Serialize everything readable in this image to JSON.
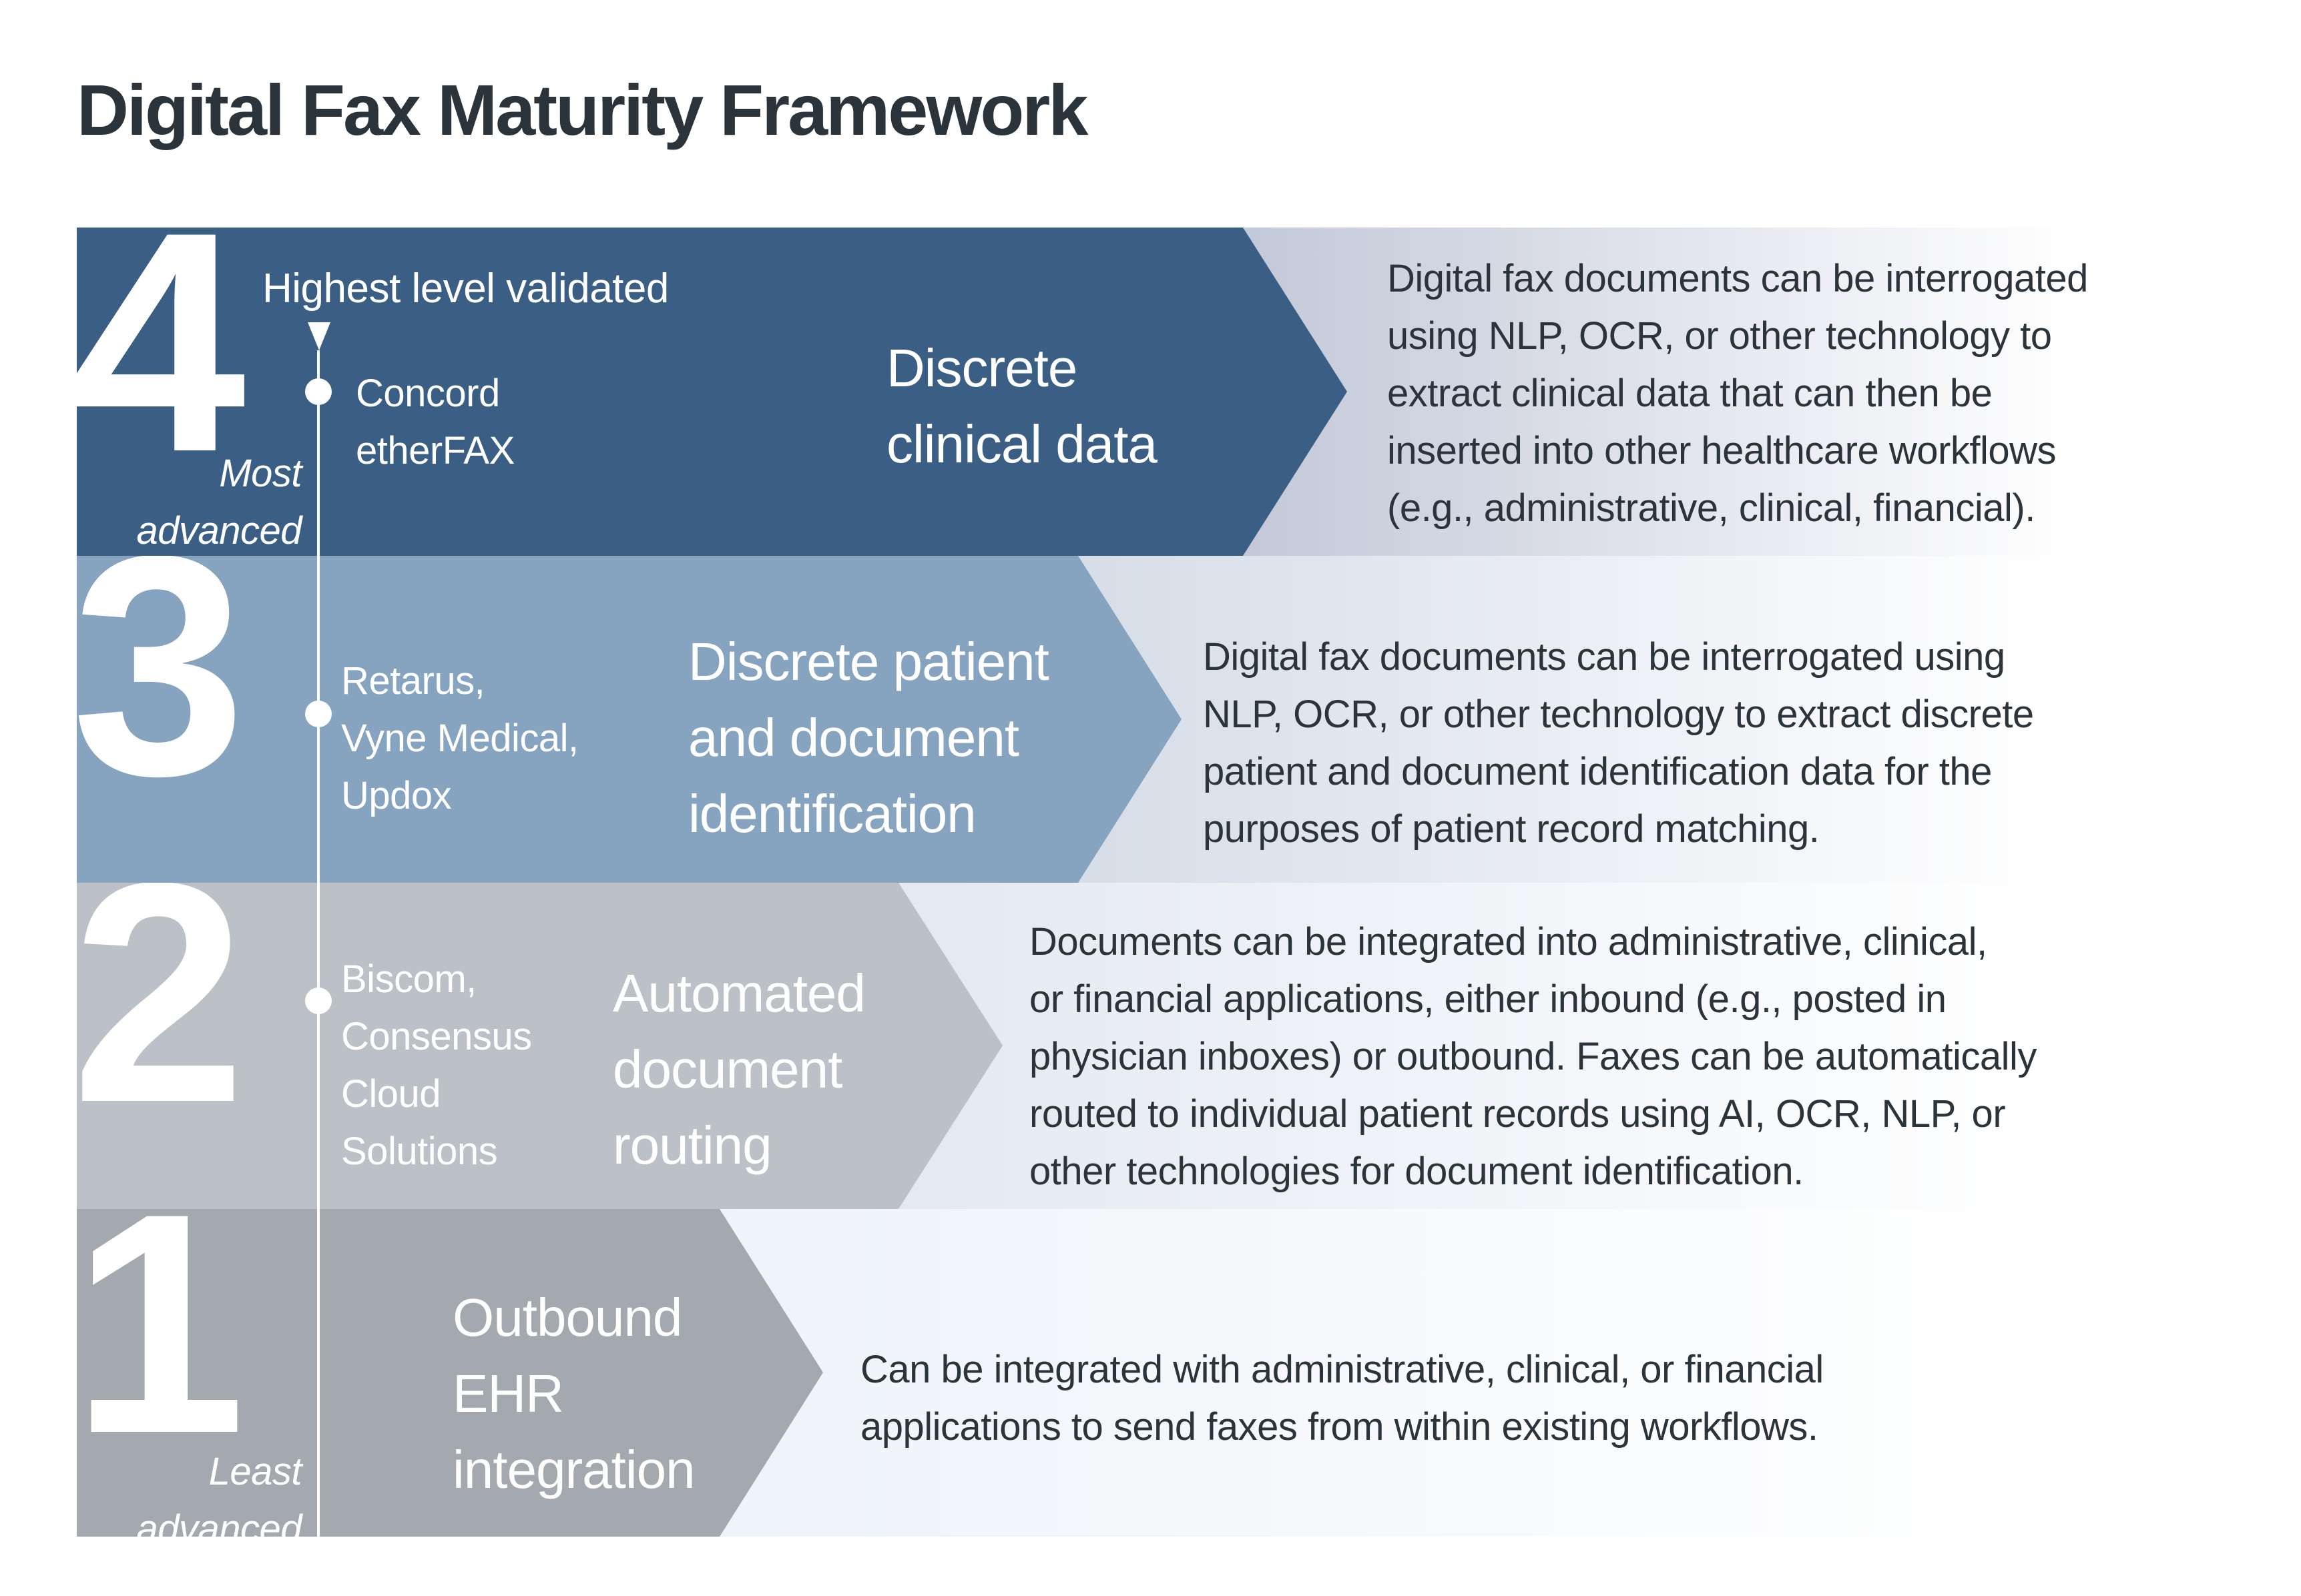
{
  "title": "Digital Fax Maturity Framework",
  "timeline": {
    "marker_label": "Highest level validated",
    "top_label": [
      "Most",
      "advanced"
    ],
    "bottom_label": [
      "Least",
      "advanced"
    ]
  },
  "colors": {
    "title": "#2b333b",
    "level4": "#3b5f84",
    "level3": "#86a4c0",
    "level2": "#bcc1c8",
    "level1": "#a4a9b0",
    "level4_panel": "#bcc2d4",
    "level3_panel": "#d3dbe6",
    "level2_panel": "#e3e9f1",
    "level1_panel": "#eef3f8"
  },
  "levels": [
    {
      "number": "4",
      "title_lines": [
        "Discrete",
        "clinical data"
      ],
      "vendors": [
        "Concord",
        "etherFAX"
      ],
      "description_lines": [
        "Digital fax documents can be interrogated",
        "using NLP, OCR, or other technology to",
        "extract clinical data that can then be",
        "inserted into other healthcare workflows",
        "(e.g., administrative, clinical, financial)."
      ]
    },
    {
      "number": "3",
      "title_lines": [
        "Discrete patient",
        "and document",
        "identification"
      ],
      "vendors": [
        "Retarus,",
        "Vyne Medical,",
        "Updox"
      ],
      "description_lines": [
        "Digital fax documents can be interrogated using",
        "NLP, OCR, or other technology to extract discrete",
        "patient and document identification data for the",
        "purposes of patient record matching."
      ]
    },
    {
      "number": "2",
      "title_lines": [
        "Automated",
        "document",
        "routing"
      ],
      "vendors": [
        "Biscom,",
        "Consensus",
        "Cloud",
        "Solutions"
      ],
      "description_lines": [
        "Documents can be integrated into administrative, clinical,",
        "or financial applications, either inbound (e.g., posted in",
        "physician inboxes) or outbound. Faxes can be automatically",
        "routed to individual patient records using AI, OCR, NLP, or",
        "other technologies for document identification."
      ]
    },
    {
      "number": "1",
      "title_lines": [
        "Outbound",
        "EHR",
        "integration"
      ],
      "vendors": [],
      "description_lines": [
        "Can be integrated with administrative, clinical, or financial",
        "applications to send faxes from within existing workflows."
      ]
    }
  ]
}
